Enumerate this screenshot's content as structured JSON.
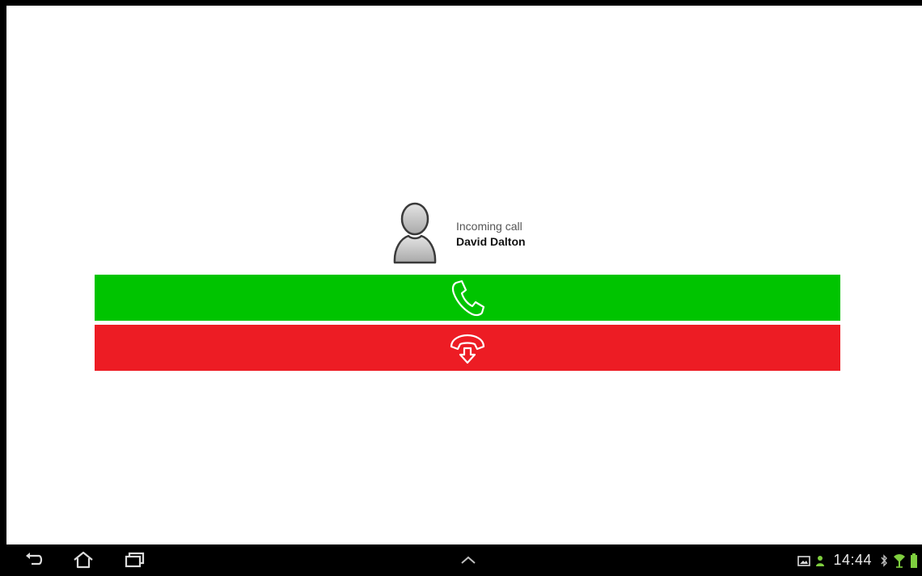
{
  "incoming_call": {
    "label": "Incoming call",
    "caller_name": "David Dalton"
  },
  "buttons": {
    "accept": {
      "icon": "phone-icon",
      "color": "#00c400"
    },
    "decline": {
      "icon": "hangup-icon",
      "color": "#ed1c24"
    }
  },
  "status_bar": {
    "time": "14:44",
    "icons": [
      "gallery-notification-icon",
      "user-notification-icon",
      "bluetooth-icon",
      "wifi-icon",
      "battery-icon"
    ]
  },
  "nav_bar": {
    "icons": [
      "back-icon",
      "home-icon",
      "recent-apps-icon",
      "expand-up-icon"
    ]
  },
  "colors": {
    "background": "#ffffff",
    "nav_bar": "#000000",
    "accept": "#00c400",
    "decline": "#ed1c24"
  }
}
